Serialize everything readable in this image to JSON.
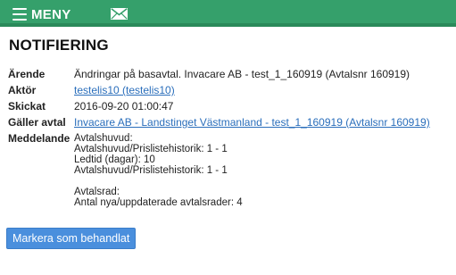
{
  "nav": {
    "menu_label": "MENY",
    "menu_icon": "hamburger-icon",
    "mail_icon": "envelope-icon",
    "bar_color": "#35a06b"
  },
  "page": {
    "title": "NOTIFIERING"
  },
  "details": {
    "arende_label": "Ärende",
    "arende_value": "Ändringar på basavtal. Invacare AB - test_1_160919 (Avtalsnr 160919)",
    "aktor_label": "Aktör",
    "aktor_value": "testelis10 (testelis10)",
    "skickat_label": "Skickat",
    "skickat_value": "2016-09-20 01:00:47",
    "galler_label": "Gäller avtal",
    "galler_value": "Invacare AB - Landstinget Västmanland - test_1_160919 (Avtalsnr 160919)",
    "meddelande_label": "Meddelande",
    "meddelande_lines": [
      "Avtalshuvud:",
      "Avtalshuvud/Prislistehistorik: 1 - 1",
      "Ledtid (dagar): 10",
      "Avtalshuvud/Prislistehistorik: 1 - 1",
      "",
      "Avtalsrad:",
      "Antal nya/uppdaterade avtalsrader: 4"
    ]
  },
  "actions": {
    "mark_handled_label": "Markera som behandlat",
    "button_color": "#4a8fdd"
  }
}
